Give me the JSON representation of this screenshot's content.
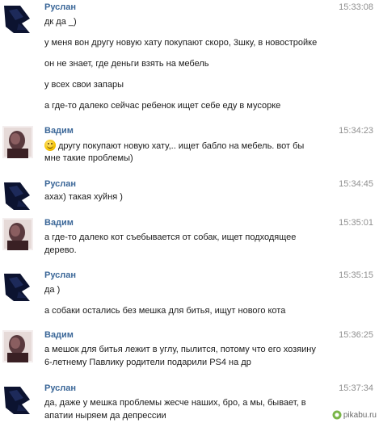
{
  "messages": [
    {
      "author": "Руслан",
      "time": "15:33:08",
      "avatar": "ruslan",
      "lines": [
        "дк да _)",
        "у меня вон другу новую хату покупают скоро, 3шку, в новостройке",
        "он не знает, где деньги взять на мебель",
        "у всех свои запары",
        "а где-то далеко сейчас ребенок ищет себе еду в мусорке"
      ]
    },
    {
      "author": "Вадим",
      "time": "15:34:23",
      "avatar": "vadim",
      "lines": [
        "другу покупают новую хату,.. ищет бабло на мебель. вот бы",
        "мне такие проблемы)"
      ],
      "emoji": "smile-emoji"
    },
    {
      "author": "Руслан",
      "time": "15:34:45",
      "avatar": "ruslan",
      "lines": [
        "ахах) такая хуйня )"
      ]
    },
    {
      "author": "Вадим",
      "time": "15:35:01",
      "avatar": "vadim",
      "lines": [
        "а где-то далеко кот съебывается от собак, ищет подходящее",
        "дерево."
      ]
    },
    {
      "author": "Руслан",
      "time": "15:35:15",
      "avatar": "ruslan",
      "lines": [
        "да )",
        "а собаки остались без мешка для битья, ищут нового кота"
      ]
    },
    {
      "author": "Вадим",
      "time": "15:36:25",
      "avatar": "vadim",
      "lines": [
        "а мешок для битья лежит в углу, пылится, потому что его хозяину",
        "6-летнему Павлику родители подарили PS4 на др"
      ]
    },
    {
      "author": "Руслан",
      "time": "15:37:34",
      "avatar": "ruslan",
      "lines": [
        "да, даже у мешка проблемы жесче наших, бро, а мы, бывает, в",
        "апатии ныряем да депрессии"
      ]
    }
  ],
  "watermark": {
    "text": "pikabu.ru"
  },
  "colors": {
    "author": "#3b6798",
    "time": "#8f8f8f",
    "text": "#1b1b1b"
  }
}
